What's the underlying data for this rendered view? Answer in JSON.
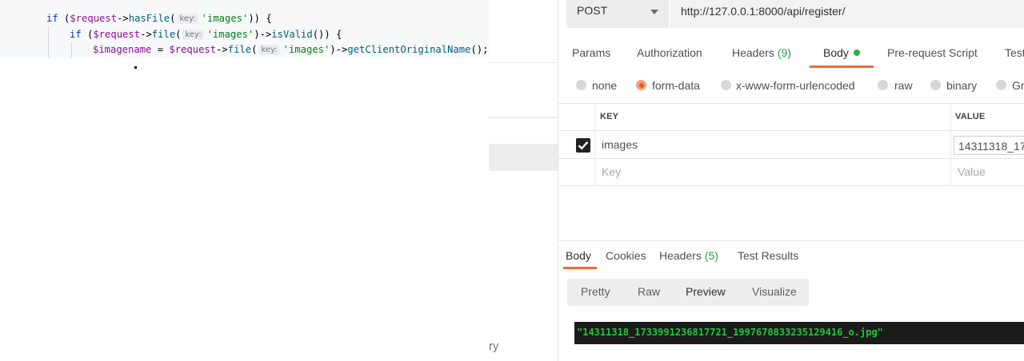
{
  "code": {
    "line1": {
      "if": "if",
      "open": " (",
      "var": "$request",
      "arrow": "->",
      "fn": "hasFile",
      "paren": "(",
      "hint": "key:",
      "str": "'images'",
      "close": ")) {"
    },
    "line2": {
      "if": "if",
      "open": " (",
      "var": "$request",
      "arrow": "->",
      "fn": "file",
      "paren": "(",
      "hint": "key:",
      "str": "'images'",
      "close": ")->",
      "fn2": "isValid",
      "tail": "()) {"
    },
    "line3": {
      "var": "$imagename",
      "eq": " = ",
      "var2": "$request",
      "arrow": "->",
      "fn": "file",
      "paren": "(",
      "hint": "key:",
      "str": "'images'",
      "close": ")->",
      "fn2": "getClientOriginalName",
      "tail": "();"
    }
  },
  "background": {
    "partial_text": "ry"
  },
  "postman": {
    "method": "POST",
    "url": "http://127.0.0.1:8000/api/register/",
    "request_tabs": [
      {
        "label": "Params"
      },
      {
        "label": "Authorization"
      },
      {
        "label": "Headers",
        "count": "(9)"
      },
      {
        "label": "Body"
      },
      {
        "label": "Pre-request Script"
      },
      {
        "label": "Test"
      }
    ],
    "body_types": [
      {
        "label": "none"
      },
      {
        "label": "form-data"
      },
      {
        "label": "x-www-form-urlencoded"
      },
      {
        "label": "raw"
      },
      {
        "label": "binary"
      },
      {
        "label": "Gr"
      }
    ],
    "selected_body_type": "form-data",
    "table": {
      "headers": {
        "key": "KEY",
        "value": "VALUE"
      },
      "rows": [
        {
          "key": "images",
          "value": "14311318_17",
          "checked": true
        }
      ],
      "placeholder": {
        "key": "Key",
        "value": "Value"
      }
    },
    "response_tabs": [
      {
        "label": "Body"
      },
      {
        "label": "Cookies"
      },
      {
        "label": "Headers",
        "count": "(5)"
      },
      {
        "label": "Test Results"
      }
    ],
    "view_modes": [
      "Pretty",
      "Raw",
      "Preview",
      "Visualize"
    ],
    "active_view_mode": "Preview",
    "response_body": "\"14311318_1733991236817721_1997678833235129416_o.jpg\"",
    "colors": {
      "accent": "#ef6c2f",
      "active_dot": "#26b14b",
      "count": "#26a345",
      "response_text": "#23c737"
    }
  }
}
